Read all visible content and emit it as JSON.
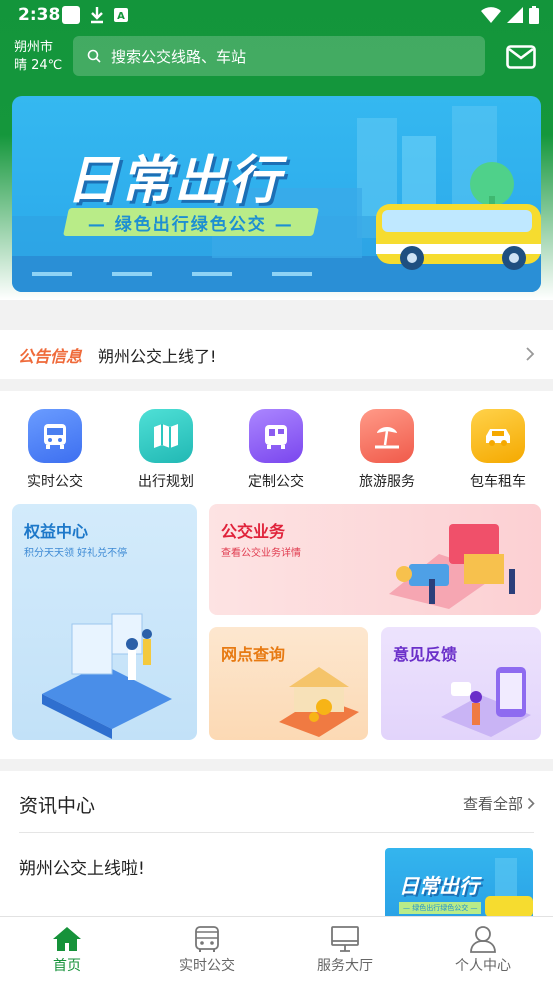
{
  "status_bar": {
    "time": "2:38"
  },
  "header": {
    "city": "朔州市",
    "weather": "晴 24℃",
    "search_placeholder": "搜索公交线路、车站"
  },
  "banner": {
    "title": "日常出行",
    "subtitle": "— 绿色出行绿色公交 —"
  },
  "notice": {
    "tag": "公告信息",
    "text": "朔州公交上线了!"
  },
  "services": [
    {
      "label": "实时公交",
      "icon": "bus-icon",
      "color": "#4a7ff0"
    },
    {
      "label": "出行规划",
      "icon": "map-icon",
      "color": "#2cc7c0"
    },
    {
      "label": "定制公交",
      "icon": "custom-bus-icon",
      "color": "#8b5cf0"
    },
    {
      "label": "旅游服务",
      "icon": "island-icon",
      "color": "#f76b5a"
    },
    {
      "label": "包车租车",
      "icon": "car-icon",
      "color": "#f7b416"
    }
  ],
  "cards": {
    "rights": {
      "title": "权益中心",
      "subtitle": "积分天天领 好礼兑不停"
    },
    "bus_business": {
      "title": "公交业务",
      "subtitle": "查看公交业务详情"
    },
    "outlets": {
      "title": "网点查询"
    },
    "feedback": {
      "title": "意见反馈"
    }
  },
  "news": {
    "title": "资讯中心",
    "more": "查看全部",
    "item_title": "朔州公交上线啦!",
    "thumb_title": "日常出行",
    "thumb_sub": "— 绿色出行绿色公交 —"
  },
  "tabbar": [
    {
      "label": "首页",
      "icon": "home-icon",
      "active": true
    },
    {
      "label": "实时公交",
      "icon": "bus-outline-icon",
      "active": false
    },
    {
      "label": "服务大厅",
      "icon": "monitor-icon",
      "active": false
    },
    {
      "label": "个人中心",
      "icon": "user-icon",
      "active": false
    }
  ],
  "colors": {
    "primary": "#16923a",
    "notice_tag": "#ef6a3a"
  }
}
